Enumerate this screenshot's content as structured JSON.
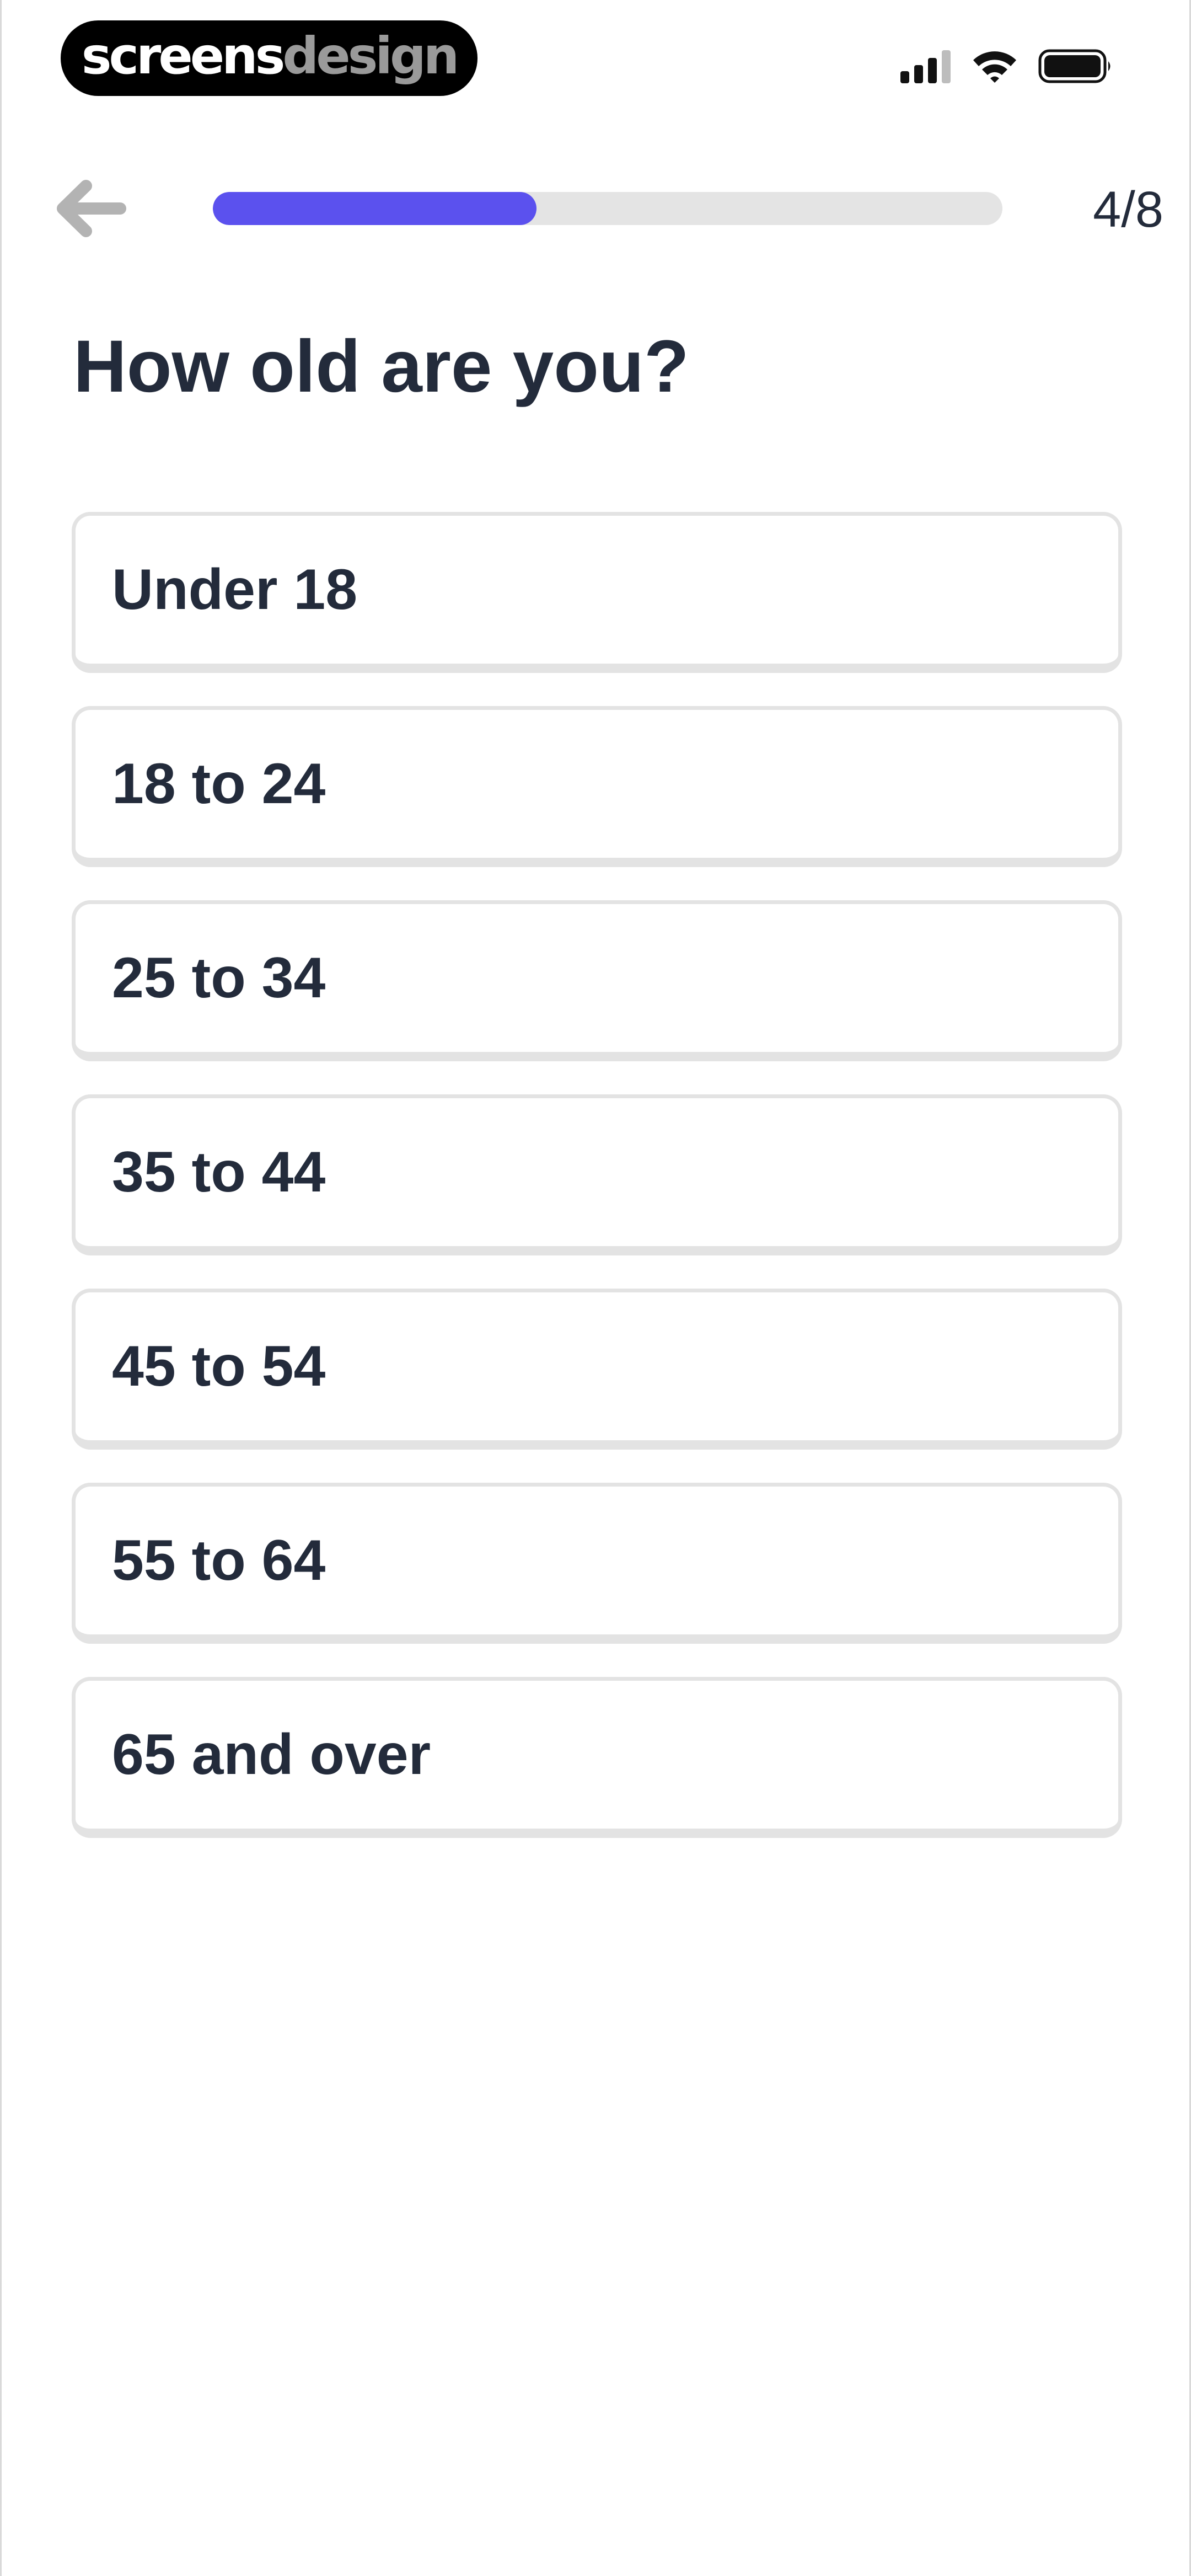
{
  "status_bar": {
    "brand_strong": "screens",
    "brand_light": "design",
    "signal_icon": "cellular-signal-icon",
    "wifi_icon": "wifi-icon",
    "battery_icon": "battery-icon"
  },
  "header": {
    "back_icon": "arrow-left-icon",
    "progress": {
      "current": 4,
      "total": 8,
      "fraction": 0.41
    },
    "step_label": "4/8"
  },
  "question": {
    "title": "How old are you?"
  },
  "options": [
    {
      "label": "Under 18"
    },
    {
      "label": "18 to 24"
    },
    {
      "label": "25 to 34"
    },
    {
      "label": "35 to 44"
    },
    {
      "label": "45 to 54"
    },
    {
      "label": "55 to 64"
    },
    {
      "label": "65 and over"
    }
  ],
  "colors": {
    "accent": "#5b51ee",
    "text": "#232b3b",
    "track": "#e4e4e4",
    "card_border": "#e3e3e3",
    "back_arrow": "#b3b3b3"
  }
}
